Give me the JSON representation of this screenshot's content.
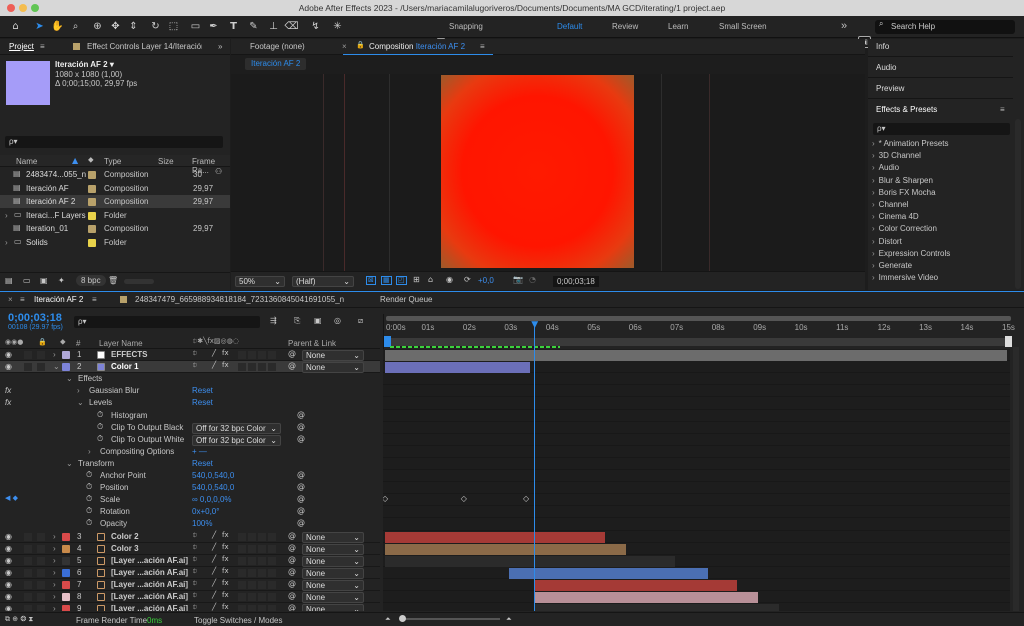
{
  "window": {
    "title": "Adobe After Effects 2023 - /Users/mariacamilalugoriveros/Documents/Documents/MA GCD/iterating/1 project.aep"
  },
  "toolbar": {
    "snapping": "Snapping",
    "workspaces": [
      "Default",
      "Review",
      "Learn",
      "Small Screen"
    ],
    "more": "»",
    "search": "Search Help"
  },
  "project": {
    "tab": "Project",
    "effect_controls": "Effect Controls Layer 14/Iteración",
    "comp_name": "Iteración AF 2 ▾",
    "comp_size": "1080 x 1080 (1,00)",
    "comp_dur": "Δ 0;00;15;00, 29,97 fps",
    "search_placeholder": "ρ▾",
    "columns": {
      "name": "Name",
      "type": "Type",
      "size": "Size",
      "fr": "Frame Ra..."
    },
    "items": [
      {
        "name": "2483474...055_n",
        "type": "Composition",
        "fr": "30",
        "color": "#b8a16a",
        "kind": "comp",
        "selected": false
      },
      {
        "name": "Iteración AF",
        "type": "Composition",
        "fr": "29,97",
        "color": "#b8a16a",
        "kind": "comp",
        "selected": false
      },
      {
        "name": "Iteración AF 2",
        "type": "Composition",
        "fr": "29,97",
        "color": "#b8a16a",
        "kind": "comp",
        "selected": true
      },
      {
        "name": "Iteraci...F Layers",
        "type": "Folder",
        "fr": "",
        "color": "#e8d24a",
        "kind": "folder",
        "selected": false
      },
      {
        "name": "Iteration_01",
        "type": "Composition",
        "fr": "29,97",
        "color": "#b8a16a",
        "kind": "comp",
        "selected": false
      },
      {
        "name": "Solids",
        "type": "Folder",
        "fr": "",
        "color": "#e8d24a",
        "kind": "folder",
        "selected": false
      }
    ],
    "bpc": "8 bpc"
  },
  "viewer": {
    "footage_tab": "Footage (none)",
    "comp_tab_prefix": "Composition",
    "comp_tab_name": "Iteración AF 2",
    "comp_chip": "Iteración AF 2",
    "zoom": "50%",
    "resolution": "(Half)",
    "exposure": "+0,0",
    "timecode": "0;00;03;18"
  },
  "right": {
    "info": "Info",
    "audio": "Audio",
    "preview": "Preview",
    "effects_presets": "Effects & Presets",
    "search_placeholder": "ρ▾",
    "categories": [
      "* Animation Presets",
      "3D Channel",
      "Audio",
      "Blur & Sharpen",
      "Boris FX Mocha",
      "Channel",
      "Cinema 4D",
      "Color Correction",
      "Distort",
      "Expression Controls",
      "Generate",
      "Immersive Video"
    ]
  },
  "timeline": {
    "tab": "Iteración AF 2",
    "tab2": "248347479_665988934818184_7231360845041691055_n",
    "render_queue": "Render Queue",
    "timecode": "0;00;03;18",
    "frame_info": "00108 (29.97 fps)",
    "search_placeholder": "ρ▾",
    "headers": {
      "num": "#",
      "layer_name": "Layer Name",
      "parent": "Parent & Link"
    },
    "ruler": [
      "0:00s",
      "01s",
      "02s",
      "03s",
      "04s",
      "05s",
      "06s",
      "07s",
      "08s",
      "09s",
      "10s",
      "11s",
      "12s",
      "13s",
      "14s",
      "15s"
    ],
    "playhead_seconds": 3.6,
    "duration_seconds": 15,
    "layers_top": [
      {
        "num": "1",
        "name": "EFFECTS",
        "color": "#b0a8d8",
        "swatch": "#ffffff",
        "parent": "None"
      },
      {
        "num": "2",
        "name": "Color 1",
        "color": "#7d83d8",
        "swatch": "#7d83d8",
        "parent": "None",
        "selected": true
      }
    ],
    "props": [
      {
        "label": "Effects",
        "indent": 0,
        "value": ""
      },
      {
        "label": "Gaussian Blur",
        "indent": 1,
        "value": "Reset",
        "fx": true
      },
      {
        "label": "Levels",
        "indent": 1,
        "value": "Reset",
        "fx": true
      },
      {
        "label": "Histogram",
        "indent": 3,
        "value": ""
      },
      {
        "label": "Clip To Output Black",
        "indent": 3,
        "value": "",
        "select": "Off for 32 bpc Color"
      },
      {
        "label": "Clip To Output White",
        "indent": 3,
        "value": "",
        "select": "Off for 32 bpc Color"
      },
      {
        "label": "Compositing Options",
        "indent": 2,
        "value": "+ —"
      },
      {
        "label": "Transform",
        "indent": 0,
        "value": "Reset"
      },
      {
        "label": "Anchor Point",
        "indent": 2,
        "value": "540,0,540,0"
      },
      {
        "label": "Position",
        "indent": 2,
        "value": "540,0,540,0"
      },
      {
        "label": "Scale",
        "indent": 2,
        "value": "∞ 0,0,0,0%"
      },
      {
        "label": "Rotation",
        "indent": 2,
        "value": "0x+0,0°"
      },
      {
        "label": "Opacity",
        "indent": 2,
        "value": "100%"
      }
    ],
    "layers_bottom": [
      {
        "num": "3",
        "name": "Color 2",
        "label": "#d94a4a",
        "parent": "None"
      },
      {
        "num": "4",
        "name": "Color 3",
        "label": "#c98a4a",
        "parent": "None"
      },
      {
        "num": "5",
        "name": "[Layer ...ación AF.ai]",
        "label": "#333333",
        "parent": "None"
      },
      {
        "num": "6",
        "name": "[Layer ...ación AF.ai]",
        "label": "#3a6ed6",
        "parent": "None"
      },
      {
        "num": "7",
        "name": "[Layer ...ación AF.ai]",
        "label": "#d94a4a",
        "parent": "None"
      },
      {
        "num": "8",
        "name": "[Layer ...ación AF.ai]",
        "label": "#e8c0c8",
        "parent": "None"
      },
      {
        "num": "9",
        "name": "[Layer ...ación AF.ai]",
        "label": "#d94a4a",
        "parent": "None"
      }
    ],
    "bars": [
      {
        "row": 0,
        "start": 0,
        "end": 15,
        "color": "#6c6c6c"
      },
      {
        "row": 1,
        "start": 0,
        "end": 3.5,
        "color": "#6b6fb8"
      },
      {
        "row": 15,
        "start": 0,
        "end": 5.3,
        "color": "#a53a36"
      },
      {
        "row": 16,
        "start": 0,
        "end": 5.8,
        "color": "#8b6a48"
      },
      {
        "row": 17,
        "start": 0,
        "end": 7.0,
        "color": "#2b2b2b"
      },
      {
        "row": 18,
        "start": 3.0,
        "end": 7.8,
        "color": "#4b6fb3"
      },
      {
        "row": 19,
        "start": 3.6,
        "end": 8.5,
        "color": "#a53a36"
      },
      {
        "row": 20,
        "start": 3.6,
        "end": 9.0,
        "color": "#b89098"
      },
      {
        "row": 21,
        "start": 3.6,
        "end": 9.5,
        "color": "#2b2b2b"
      }
    ],
    "footer": {
      "frame_render": "Frame Render Time",
      "frame_render_val": "0ms",
      "toggle": "Toggle Switches / Modes"
    }
  },
  "colors": {
    "accent": "#2d8ceb",
    "canvas_center": "#ff1a00",
    "canvas_edge": "#8a5a28"
  }
}
